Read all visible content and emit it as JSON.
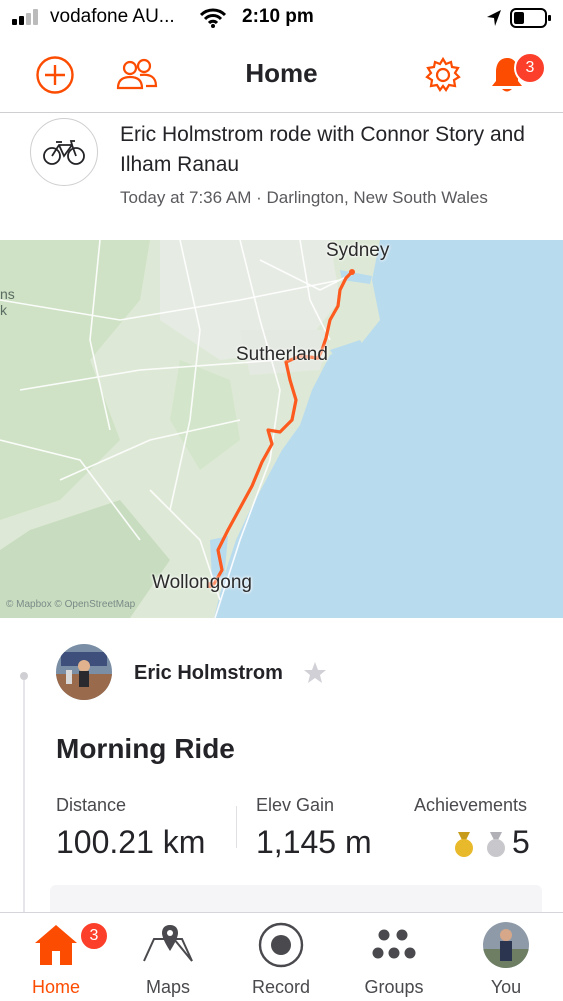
{
  "status_bar": {
    "carrier": "vodafone AU...",
    "time": "2:10 pm"
  },
  "header": {
    "title": "Home",
    "notification_count": "3",
    "icons": [
      "add-icon",
      "people-icon",
      "gear-icon",
      "bell-icon"
    ]
  },
  "activity": {
    "headline": "Eric Holmstrom rode with Connor Story and Ilham Ranau",
    "meta": "Today at 7:36 AM · Darlington, New South Wales",
    "sport_icon": "bicycle-icon",
    "map": {
      "labels": {
        "start": "Sydney",
        "mid": "Sutherland",
        "end": "Wollongong"
      },
      "edge_text": "ns k",
      "credit": "© Mapbox © OpenStreetMap"
    },
    "athlete_name": "Eric Holmstrom",
    "title": "Morning Ride",
    "stats": {
      "distance_label": "Distance",
      "distance_value": "100.21 km",
      "elev_label": "Elev Gain",
      "elev_value": "1,145 m",
      "achievements_label": "Achievements",
      "achievements_value": "5"
    }
  },
  "colors": {
    "accent": "#fc4c02",
    "badge": "#fc3f2a",
    "route": "#fc5a1e",
    "sea": "#b9dbee",
    "land": "#dde9d6",
    "gold": "#e8b92a",
    "silver": "#c8c8cc"
  },
  "tab_bar": {
    "active": "Home",
    "home_badge": "3",
    "tabs": [
      {
        "label": "Home",
        "icon": "home-icon"
      },
      {
        "label": "Maps",
        "icon": "map-icon"
      },
      {
        "label": "Record",
        "icon": "record-icon"
      },
      {
        "label": "Groups",
        "icon": "groups-icon"
      },
      {
        "label": "You",
        "icon": "profile-avatar"
      }
    ]
  }
}
